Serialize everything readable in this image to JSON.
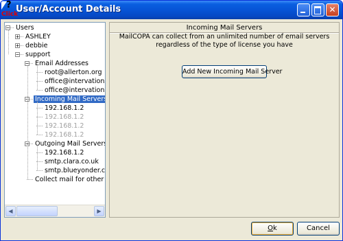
{
  "window": {
    "title": "User/Account Details",
    "help_cursor_label": "Click"
  },
  "tree": {
    "items": [
      {
        "label": "Users",
        "indent": 0,
        "expander": "minus"
      },
      {
        "label": "ASHLEY",
        "indent": 1,
        "expander": "plus"
      },
      {
        "label": "debbie",
        "indent": 1,
        "expander": "plus"
      },
      {
        "label": "support",
        "indent": 1,
        "expander": "minus"
      },
      {
        "label": "Email Addresses",
        "indent": 2,
        "expander": "minus"
      },
      {
        "label": "root@allerton.org",
        "indent": 3
      },
      {
        "label": "office@intervations",
        "indent": 3
      },
      {
        "label": "office@intervations",
        "indent": 3
      },
      {
        "label": "Incoming Mail Servers",
        "indent": 2,
        "expander": "minus",
        "selected": true
      },
      {
        "label": "192.168.1.2",
        "indent": 3
      },
      {
        "label": "192.168.1.2",
        "indent": 3,
        "disabled": true
      },
      {
        "label": "192.168.1.2",
        "indent": 3,
        "disabled": true
      },
      {
        "label": "192.168.1.2",
        "indent": 3,
        "disabled": true
      },
      {
        "label": "Outgoing Mail Servers (S",
        "indent": 2,
        "expander": "minus"
      },
      {
        "label": "192.168.1.2",
        "indent": 3
      },
      {
        "label": "smtp.clara.co.uk",
        "indent": 3
      },
      {
        "label": "smtp.blueyonder.co",
        "indent": 3
      },
      {
        "label": "Collect mail for other us",
        "indent": 2
      }
    ]
  },
  "detail": {
    "title": "Incoming Mail Servers",
    "description": "MailCOPA can collect from an unlimited number of email servers regardless of the type of license you have",
    "add_button": "Add New Incoming Mail Server"
  },
  "footer": {
    "ok": {
      "mnemonic": "O",
      "rest": "k"
    },
    "cancel": "Cancel"
  },
  "colors": {
    "titlebar": "#0754d6",
    "selection": "#316ac5",
    "disabled_text": "#a0a0a0"
  }
}
